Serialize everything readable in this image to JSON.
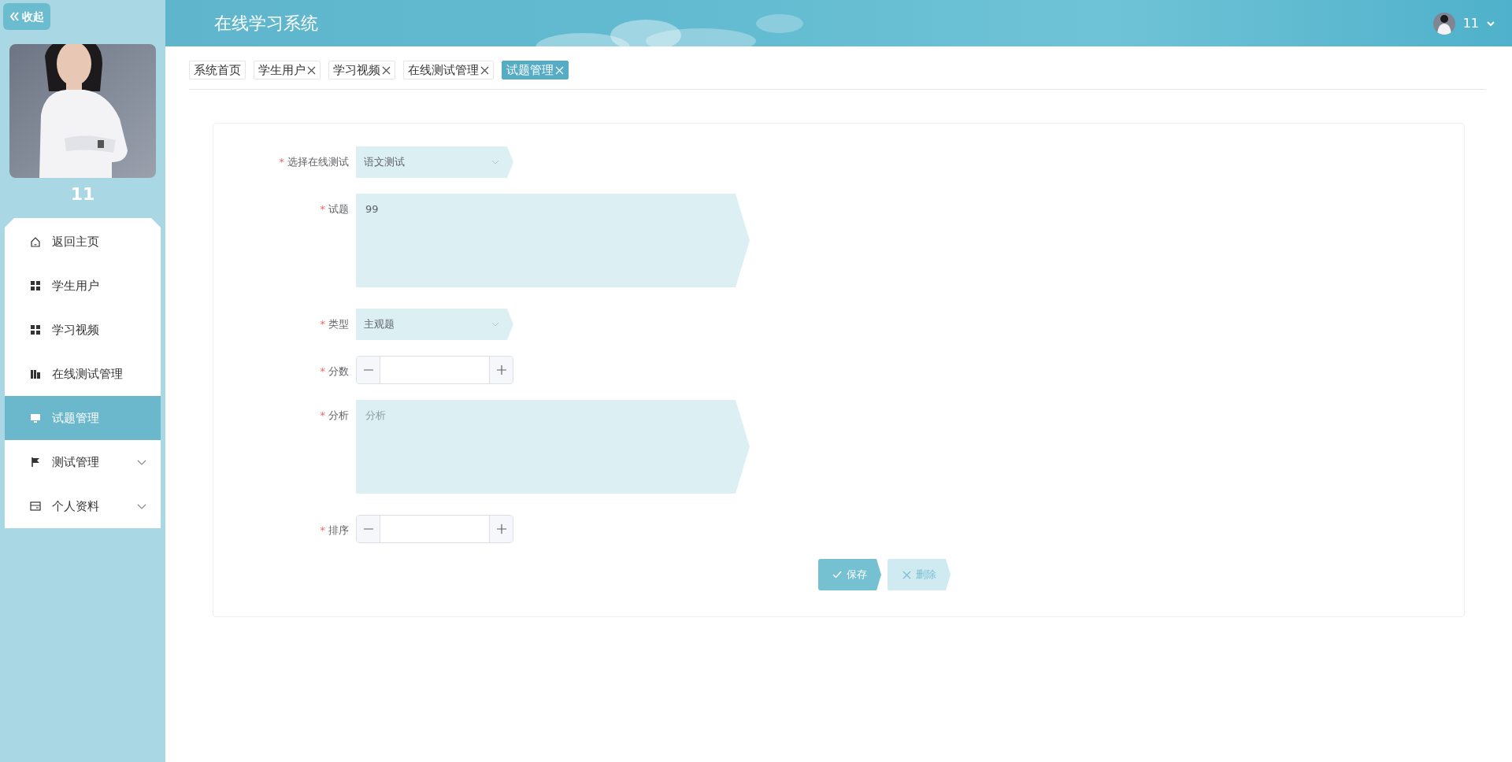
{
  "sidebar": {
    "collapse_button": "收起",
    "user_name": "11",
    "menu": [
      {
        "label": "返回主页",
        "kind": "link",
        "selected": false
      },
      {
        "label": "学生用户",
        "kind": "link",
        "selected": false
      },
      {
        "label": "学习视频",
        "kind": "link",
        "selected": false
      },
      {
        "label": "在线测试管理",
        "kind": "link",
        "selected": false
      },
      {
        "label": "试题管理",
        "kind": "link",
        "selected": true
      },
      {
        "label": "测试管理",
        "kind": "submenu",
        "selected": false
      },
      {
        "label": "个人资料",
        "kind": "submenu",
        "selected": false
      }
    ]
  },
  "header": {
    "title": "在线学习系统",
    "user_name": "11"
  },
  "tabs": [
    {
      "label": "系统首页",
      "closable": false,
      "selected": false
    },
    {
      "label": "学生用户",
      "closable": true,
      "selected": false
    },
    {
      "label": "学习视频",
      "closable": true,
      "selected": false
    },
    {
      "label": "在线测试管理",
      "closable": true,
      "selected": false
    },
    {
      "label": "试题管理",
      "closable": true,
      "selected": true
    }
  ],
  "form": {
    "fields": [
      {
        "kind": "select",
        "mark": "*",
        "label": "选择在线测试",
        "value": "语文测试"
      },
      {
        "kind": "textarea",
        "mark": "*",
        "label": "试题",
        "value": "99"
      },
      {
        "kind": "select",
        "mark": "*",
        "label": "类型",
        "value": "主观题"
      },
      {
        "kind": "number",
        "mark": "*",
        "label": "分数"
      },
      {
        "kind": "textarea",
        "mark": "*",
        "label": "分析",
        "placeholder": "分析"
      },
      {
        "kind": "number",
        "mark": "*",
        "label": "排序"
      }
    ],
    "buttons": [
      {
        "label": "保存",
        "kind": "primary"
      },
      {
        "label": "删除",
        "kind": "secondary"
      }
    ]
  }
}
